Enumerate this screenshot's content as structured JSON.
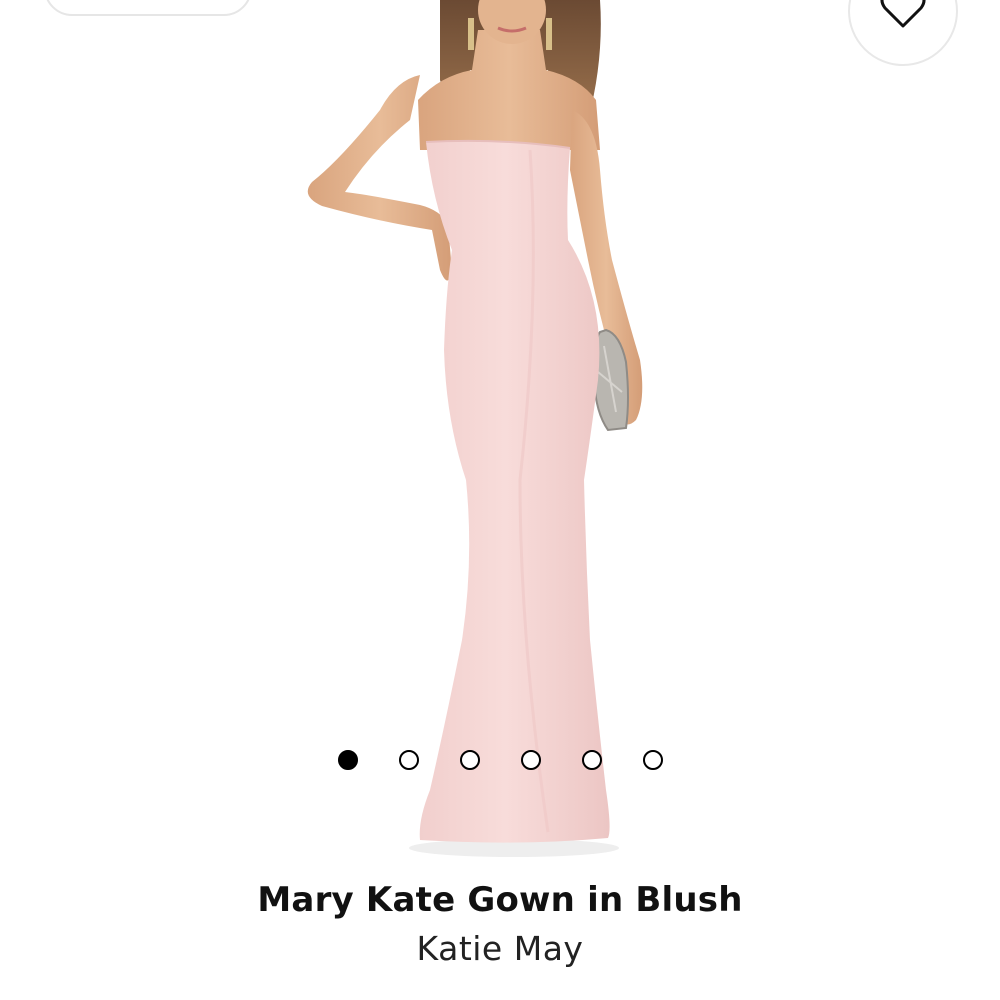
{
  "product": {
    "title": "Mary Kate Gown in Blush",
    "brand": "Katie May"
  },
  "carousel": {
    "total": 6,
    "active_index": 0
  },
  "icons": {
    "wishlist": "heart-outline-icon"
  },
  "colors": {
    "dress": "#f5d6d4",
    "skin": "#e2b38f",
    "background": "#ffffff",
    "dot_active": "#000000"
  }
}
